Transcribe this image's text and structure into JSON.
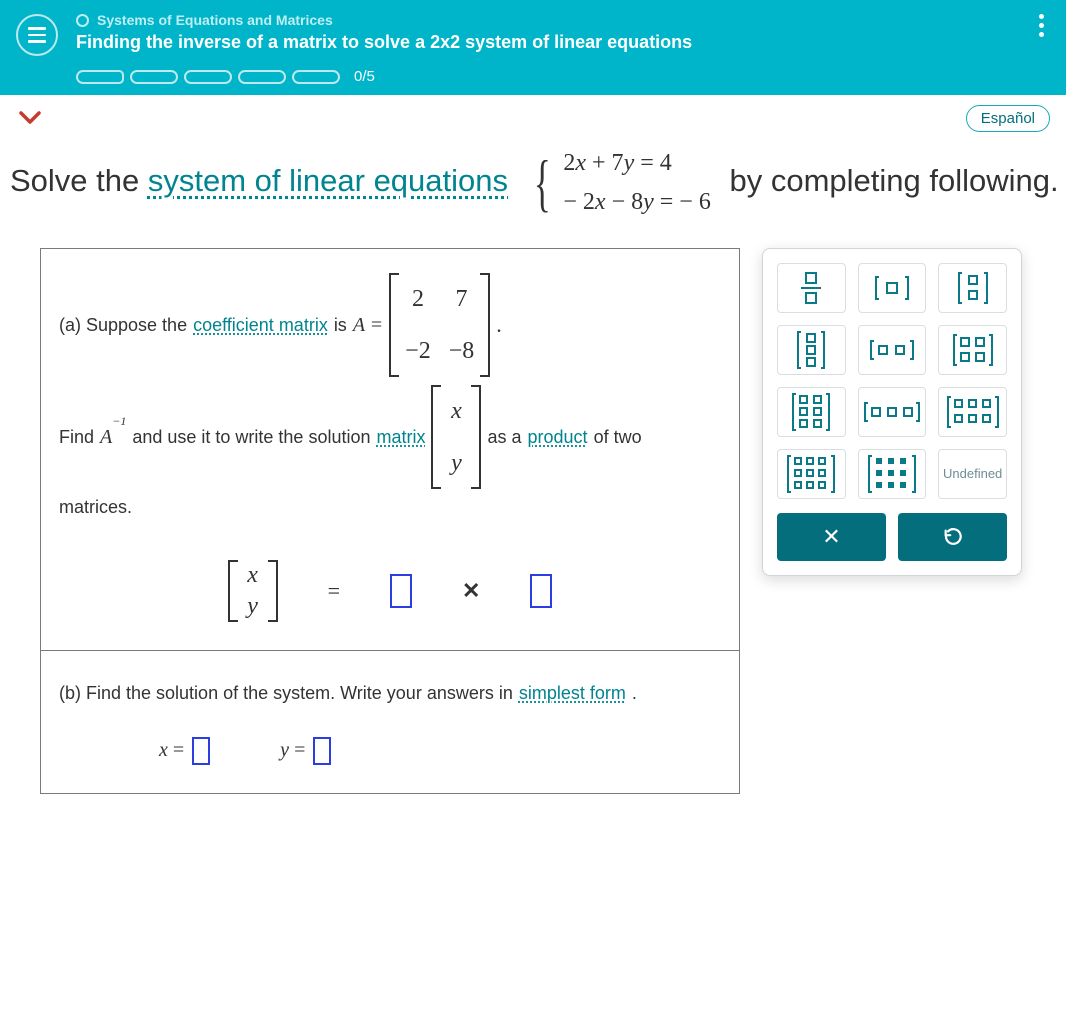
{
  "header": {
    "breadcrumb": "Systems of Equations and Matrices",
    "lesson_title": "Finding the inverse of a matrix to solve a 2x2 system of linear equations",
    "progress": "0/5"
  },
  "lang_button": "Español",
  "prompt": {
    "p1": "Solve the ",
    "link": "system of linear equations",
    "eq1": "2x + 7y = 4",
    "eq2": "− 2x − 8y = − 6",
    "p2": " by completing",
    "p3": "following."
  },
  "partA": {
    "t1": "(a) Suppose the ",
    "link1": "coefficient matrix",
    "t2": " is ",
    "Aeq": "A =",
    "matrix": {
      "r1c1": "2",
      "r1c2": "7",
      "r2c1": "−2",
      "r2c2": "−8"
    },
    "t3": "Find ",
    "Ainv": "A",
    "exp": "−1",
    "t4": " and use it to write the solution ",
    "link2": "matrix",
    "xy": {
      "top": "x",
      "bot": "y"
    },
    "t5": " as a ",
    "link3": "product",
    "t6": " of two",
    "t7": "matrices.",
    "eqsym": "=",
    "times": "✕"
  },
  "partB": {
    "t1": "(b) Find the solution of the system. Write your answers in ",
    "link": "simplest form",
    "t2": ".",
    "xlabel": "x =",
    "ylabel": "y ="
  },
  "keypad": {
    "undefined": "Undefined",
    "clear": "✕",
    "reset": "↺"
  }
}
